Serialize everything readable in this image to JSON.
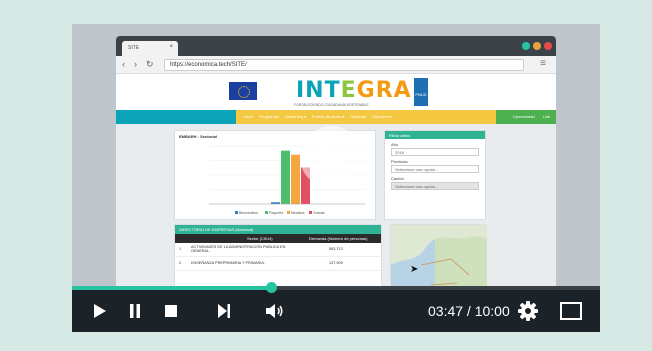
{
  "browser": {
    "tab_title": "SITE",
    "tab_close": "×",
    "url": "https://economica.tech/SITE/",
    "window_dots": [
      "#26c59f",
      "#e8a23d",
      "#e84a4a"
    ]
  },
  "site": {
    "logo": [
      "INT",
      "E",
      "GRA"
    ],
    "logo_colors": [
      "#0aa3b8",
      "#8cc63f",
      "#f39c12"
    ],
    "logo_sub": "FORTALECIENDO CIUDADANÍA SOSTENIBLE",
    "undp_label": "PNUD",
    "nav_items": [
      "Inicio",
      "Programas",
      "Screening ▾",
      "Fuente de datos ▾",
      "Contexto",
      "Reportes ▾"
    ],
    "nav_right": [
      "Oportunidad",
      "Link"
    ],
    "chart_title": "EMBARH - Sectorial",
    "filter": {
      "title": "Filtrar datos",
      "year_label": "Año",
      "year_value": "2018",
      "province_label": "Provincia",
      "province_value": "Seleccione una opción...",
      "canton_label": "Cantón",
      "canton_value": "Seleccione una opción..."
    },
    "table": {
      "title": "DIRECTORIO DE EMPRESAS (Nacional)",
      "col_sector": "Sector (CIIU4)",
      "col_demand": "Demanda (Número de personas)",
      "rows": [
        {
          "n": "1",
          "sector": "ACTIVIDADES DE LA ADMINISTRACIÓN PÚBLICA EN GENERAL.",
          "demand": "563,713"
        },
        {
          "n": "2",
          "sector": "ENSEÑANZA PREPRIMARIA Y PRIMARIA.",
          "demand": "137,909"
        }
      ]
    }
  },
  "chart_data": {
    "type": "bar",
    "categories": [
      ""
    ],
    "series": [
      {
        "name": "Bienvenidos",
        "color": "#2f7fd0",
        "values": [
          3
        ]
      },
      {
        "name": "Pequeña",
        "color": "#4cbf6e",
        "values": [
          92
        ]
      },
      {
        "name": "Mediana",
        "color": "#f4a640",
        "values": [
          85
        ]
      },
      {
        "name": "Grande",
        "color": "#e05060",
        "values": [
          63
        ]
      }
    ],
    "ylim": [
      0,
      100
    ]
  },
  "player": {
    "time": "03:47 / 10:00",
    "progress_fraction": 0.378,
    "accent": "#26c59f"
  }
}
